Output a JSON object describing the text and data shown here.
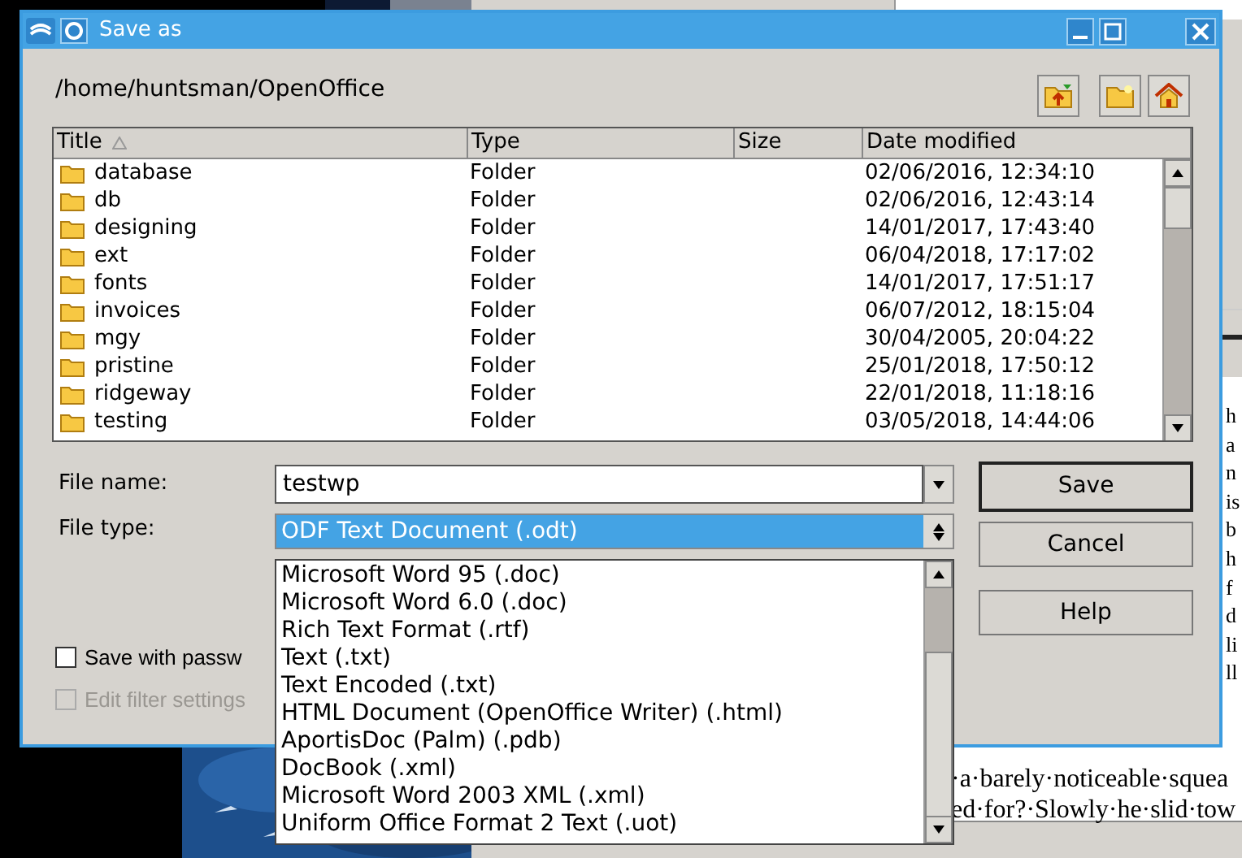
{
  "window": {
    "title": "Save as"
  },
  "path": "/home/huntsman/OpenOffice",
  "columns": [
    {
      "label": "Title",
      "sorted": true
    },
    {
      "label": "Type",
      "sorted": false
    },
    {
      "label": "Size",
      "sorted": false
    },
    {
      "label": "Date modified",
      "sorted": false
    }
  ],
  "rows": [
    {
      "title": "database",
      "type": "Folder",
      "date": "02/06/2016, 12:34:10"
    },
    {
      "title": "db",
      "type": "Folder",
      "date": "02/06/2016, 12:43:14"
    },
    {
      "title": "designing",
      "type": "Folder",
      "date": "14/01/2017, 17:43:40"
    },
    {
      "title": "ext",
      "type": "Folder",
      "date": "06/04/2018, 17:17:02"
    },
    {
      "title": "fonts",
      "type": "Folder",
      "date": "14/01/2017, 17:51:17"
    },
    {
      "title": "invoices",
      "type": "Folder",
      "date": "06/07/2012, 18:15:04"
    },
    {
      "title": "mgy",
      "type": "Folder",
      "date": "30/04/2005, 20:04:22"
    },
    {
      "title": "pristine",
      "type": "Folder",
      "date": "25/01/2018, 17:50:12"
    },
    {
      "title": "ridgeway",
      "type": "Folder",
      "date": "22/01/2018, 11:18:16"
    },
    {
      "title": "testing",
      "type": "Folder",
      "date": "03/05/2018, 14:44:06"
    }
  ],
  "file_name": {
    "label": "File name:",
    "value": "testwp"
  },
  "file_type": {
    "label": "File type:",
    "value": "ODF Text Document (.odt)",
    "expanded": true,
    "options": [
      "Microsoft Word 95 (.doc)",
      "Microsoft Word 6.0 (.doc)",
      "Rich Text Format (.rtf)",
      "Text (.txt)",
      "Text Encoded (.txt)",
      "HTML Document (OpenOffice Writer) (.html)",
      "AportisDoc (Palm) (.pdb)",
      "DocBook (.xml)",
      "Microsoft Word 2003 XML (.xml)",
      "Uniform Office Format 2 Text (.uot)"
    ]
  },
  "buttons": [
    {
      "label": "Save",
      "default": true
    },
    {
      "label": "Cancel",
      "default": false
    },
    {
      "label": "Help",
      "default": false
    }
  ],
  "checkboxes": [
    {
      "label": "Save with passw",
      "checked": false,
      "disabled": false
    },
    {
      "label": "Edit filter settings",
      "checked": false,
      "disabled": true
    }
  ],
  "document": {
    "edge_fragments": [
      "h",
      "a",
      "n",
      "is",
      "b",
      "h",
      "f",
      "d",
      "li",
      "ll"
    ],
    "lines": [
      "·a·barely·noticeable·squea",
      "ed·for?·Slowly·he·slid·tow"
    ]
  }
}
